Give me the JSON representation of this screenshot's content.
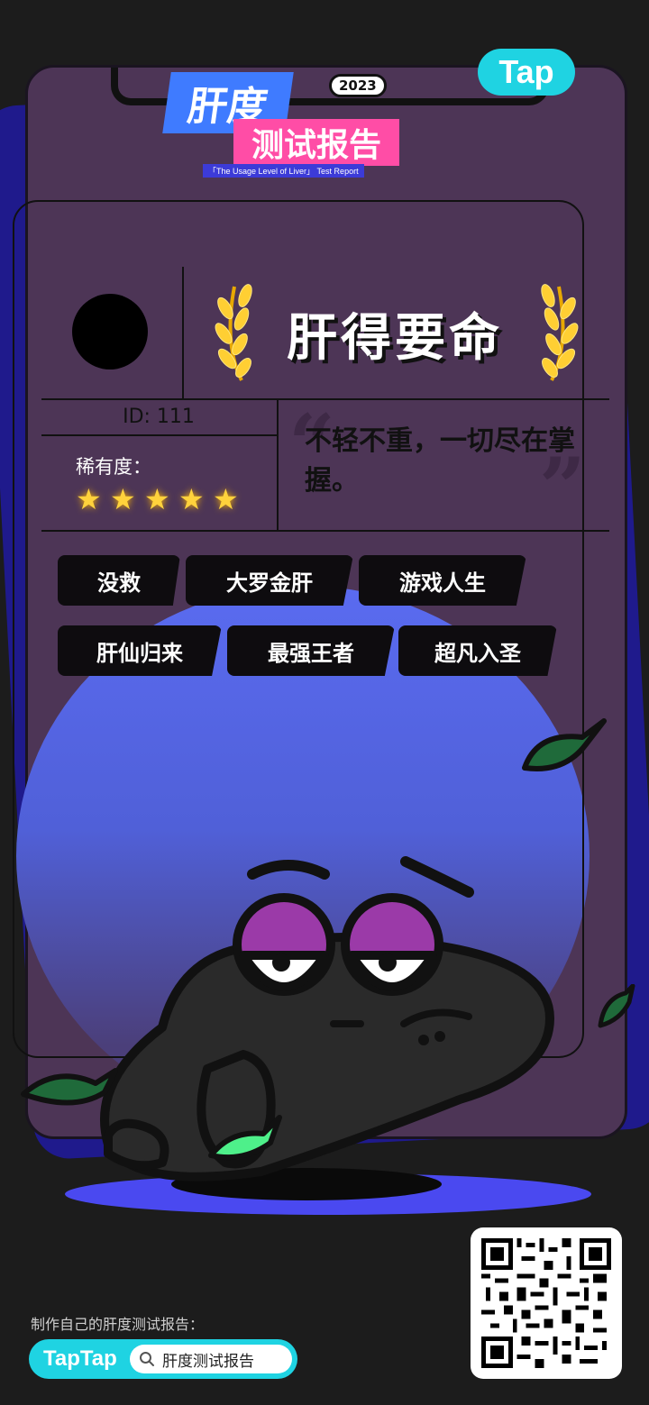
{
  "brand": {
    "badge": "Tap",
    "footer_brand": "TapTap"
  },
  "logo": {
    "line1": "肝度",
    "year": "2023",
    "line2": "测试报告",
    "subtitle": "「The Usage Level of Liver」 Test Report"
  },
  "profile": {
    "title": "肝得要命",
    "id_text": "ID: 111",
    "rarity_label": "稀有度：",
    "rarity_stars": 5,
    "quote": "不轻不重，一切尽在掌握。"
  },
  "tags": [
    "没救",
    "大罗金肝",
    "游戏人生",
    "肝仙归来",
    "最强王者",
    "超凡入圣"
  ],
  "footer": {
    "label": "制作自己的肝度测试报告：",
    "search_text": "肝度测试报告"
  },
  "colors": {
    "card": "#4d3556",
    "accent_cyan": "#1fd3e2",
    "star": "#ffd23c",
    "blob": "#5a6bf0"
  }
}
